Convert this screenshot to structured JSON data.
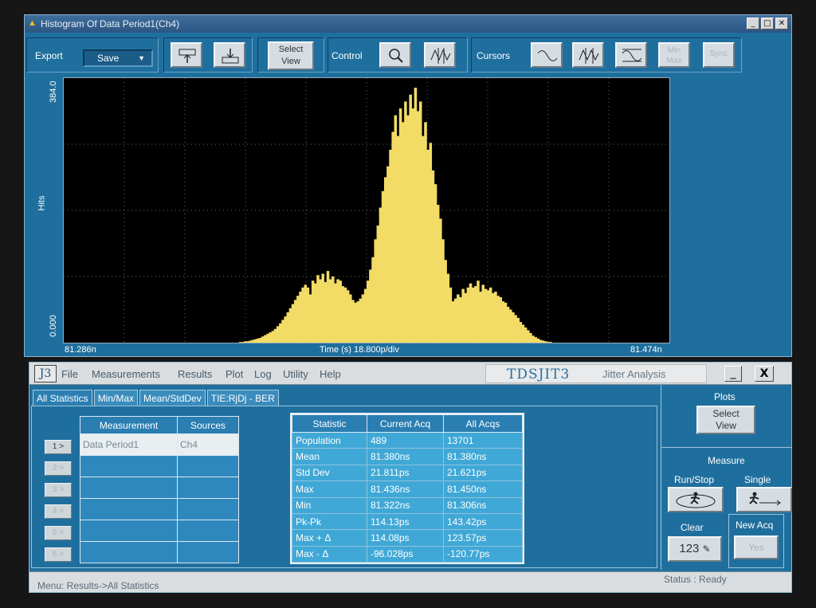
{
  "histogram_window": {
    "title": "Histogram Of Data Period1(Ch4)",
    "window_buttons": [
      "_",
      "□",
      "✕"
    ],
    "toolbar": {
      "export_label": "Export",
      "save_label": "Save",
      "select_view_line1": "Select",
      "select_view_line2": "View",
      "control_label": "Control",
      "cursors_label": "Cursors",
      "minmax_line1": "Min",
      "minmax_line2": "Max",
      "sync_label": "Sync"
    },
    "plot": {
      "y_max": "384.0",
      "y_min": "0.000",
      "y_label": "Hits",
      "x_left": "81.286n",
      "x_right": "81.474n",
      "x_label": "Time (s)   18.800p/div"
    }
  },
  "chart_data": {
    "type": "bar",
    "xlabel": "Time (s)",
    "ylabel": "Hits",
    "x_range": [
      81.286,
      81.474
    ],
    "x_unit": "ns",
    "x_scale": "18.800p/div",
    "ylim": [
      0,
      384
    ],
    "grid": true,
    "color": "#f2dc66",
    "values": [
      0,
      0,
      0,
      0,
      0,
      0,
      0,
      0,
      0,
      0,
      0,
      0,
      0,
      0,
      0,
      0,
      0,
      0,
      0,
      0,
      0,
      0,
      0,
      0,
      0,
      0,
      0,
      0,
      0,
      0,
      0,
      0,
      0,
      0,
      0,
      0,
      0,
      0,
      0,
      0,
      0,
      0,
      0,
      0,
      0,
      0,
      0,
      0,
      0,
      0,
      0,
      0,
      0,
      0,
      0,
      0,
      0,
      0,
      0,
      0,
      0,
      0,
      0,
      0,
      0,
      0,
      0,
      0,
      0,
      0,
      1,
      1,
      2,
      2,
      3,
      4,
      5,
      6,
      7,
      9,
      11,
      13,
      15,
      17,
      20,
      24,
      28,
      33,
      38,
      44,
      50,
      56,
      62,
      68,
      74,
      80,
      84,
      80,
      70,
      90,
      86,
      98,
      92,
      100,
      88,
      104,
      92,
      96,
      86,
      92,
      90,
      82,
      80,
      76,
      70,
      62,
      58,
      60,
      64,
      70,
      78,
      90,
      106,
      124,
      150,
      170,
      196,
      220,
      240,
      256,
      280,
      306,
      330,
      300,
      340,
      320,
      350,
      330,
      360,
      340,
      370,
      336,
      350,
      300,
      320,
      280,
      290,
      250,
      230,
      200,
      180,
      150,
      120,
      100,
      80,
      60,
      64,
      70,
      66,
      78,
      72,
      80,
      86,
      80,
      82,
      90,
      74,
      84,
      78,
      76,
      80,
      72,
      74,
      68,
      66,
      60,
      58,
      52,
      48,
      44,
      40,
      36,
      30,
      26,
      22,
      18,
      14,
      10,
      8,
      6,
      4,
      3,
      2,
      1,
      1,
      0,
      0,
      0,
      0,
      0,
      0,
      0,
      0,
      0,
      0,
      0,
      0,
      0,
      0,
      0,
      0,
      0,
      0,
      0,
      0,
      0,
      0,
      0,
      0,
      0,
      0,
      0,
      0,
      0,
      0,
      0,
      0,
      0,
      0,
      0,
      0,
      0,
      0,
      0,
      0,
      0,
      0,
      0,
      0,
      0,
      0,
      0
    ]
  },
  "jitter_window": {
    "logo": "J3",
    "menu": [
      "File",
      "Measurements",
      "Results",
      "Plot",
      "Log",
      "Utility",
      "Help"
    ],
    "brand": "TDSJIT3",
    "brand_sub": "Jitter  Analysis",
    "min_label": "_",
    "close_label": "X",
    "tabs": [
      "All Statistics",
      "Min/Max",
      "Mean/StdDev",
      "TIE:RjDj - BER"
    ],
    "row_buttons": [
      "1 >",
      "2 >",
      "3 >",
      "4 >",
      "5 >",
      "6 >"
    ],
    "measurement_table": {
      "headers": [
        "Measurement",
        "Sources"
      ],
      "rows": [
        [
          "Data Period1",
          "Ch4"
        ],
        [
          "",
          ""
        ],
        [
          "",
          ""
        ],
        [
          "",
          ""
        ],
        [
          "",
          ""
        ],
        [
          "",
          ""
        ]
      ]
    },
    "stat_table": {
      "headers": [
        "Statistic",
        "Current Acq",
        "All Acqs"
      ],
      "rows": [
        [
          "Population",
          "489",
          "13701"
        ],
        [
          "Mean",
          "81.380ns",
          "81.380ns"
        ],
        [
          "Std Dev",
          "21.811ps",
          "21.621ps"
        ],
        [
          "Max",
          "81.436ns",
          "81.450ns"
        ],
        [
          "Min",
          "81.322ns",
          "81.306ns"
        ],
        [
          "Pk-Pk",
          "114.13ps",
          "143.42ps"
        ],
        [
          "Max + Δ",
          "114.08ps",
          "123.57ps"
        ],
        [
          "Max - Δ",
          "-96.028ps",
          "-120.77ps"
        ]
      ]
    },
    "right_panel": {
      "plots_label": "Plots",
      "select_view_line1": "Select",
      "select_view_line2": "View",
      "measure_label": "Measure",
      "run_stop_label": "Run/Stop",
      "single_label": "Single",
      "clear_label": "Clear",
      "clear_btn_text": "123",
      "new_acq_label": "New Acq",
      "yes_label": "Yes"
    },
    "status": {
      "menu_path": "Menu: Results->All Statistics",
      "ready": "Status : Ready"
    }
  }
}
